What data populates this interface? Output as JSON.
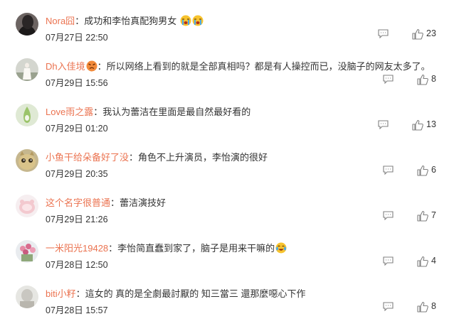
{
  "comments": [
    {
      "user": "Nora囧",
      "sep": "：",
      "text": "成功和李怡真配狗男女",
      "emoji": "crying-face-emoji",
      "emoji_count": 2,
      "time": "07月27日 22:50",
      "likes": "23"
    },
    {
      "user": "Dh入佳境",
      "sep": "：",
      "text": "所以网络上看到的就是全部真相吗？都是有人操控而已，没脑子的网友太多了。",
      "emoji": "angry-face-emoji",
      "emoji_count": 1,
      "time": "07月29日 15:56",
      "likes": "8"
    },
    {
      "user": "Love雨之露",
      "sep": "：",
      "text": "我认为蕾洁在里面是最自然最好看的",
      "emoji": "",
      "emoji_count": 0,
      "time": "07月29日 01:20",
      "likes": "13"
    },
    {
      "user": "小鱼干给朵备好了没",
      "sep": "：",
      "text": "角色不上升演员，李怡演的很好",
      "emoji": "",
      "emoji_count": 0,
      "time": "07月29日 20:35",
      "likes": "6"
    },
    {
      "user": "这个名字很普通",
      "sep": "：",
      "text": "蕾洁演技好",
      "emoji": "",
      "emoji_count": 0,
      "time": "07月29日 21:26",
      "likes": "7"
    },
    {
      "user": "一米阳光19428",
      "sep": "：",
      "text": "李怡简直蠢到家了，脑子是用来干嘛的",
      "emoji": "crying-laughing-emoji",
      "emoji_count": 1,
      "time": "07月28日 12:50",
      "likes": "4"
    },
    {
      "user": "biti小籽",
      "sep": "：",
      "text": "這女的 真的是全劇最討厭的 知三當三 還那麼噁心下作",
      "emoji": "",
      "emoji_count": 0,
      "time": "07月28日 15:57",
      "likes": "8"
    }
  ],
  "colors": {
    "username": "#eb7350",
    "text": "#333333",
    "icon": "#808080"
  }
}
